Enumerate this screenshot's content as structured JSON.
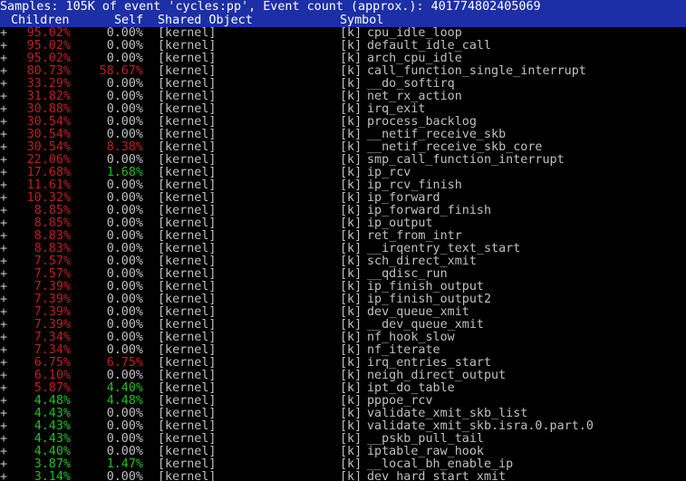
{
  "title": "Samples: 105K of event 'cycles:pp', Event count (approx.): 401774802405069",
  "headers": {
    "children": "Children",
    "self": "Self",
    "shared_object": "Shared Object",
    "symbol": "Symbol"
  },
  "colors": {
    "title_bg": "#1c2fa6",
    "high": "#c02020",
    "medium": "#22c022",
    "low": "#c0c0c0"
  },
  "rows": [
    {
      "expand": "+",
      "children": "95.02%",
      "self": "0.00%",
      "shared": "[kernel]",
      "level": "[k]",
      "symbol": "cpu_idle_loop",
      "children_color": "red",
      "self_color": "gray"
    },
    {
      "expand": "+",
      "children": "95.02%",
      "self": "0.00%",
      "shared": "[kernel]",
      "level": "[k]",
      "symbol": "default_idle_call",
      "children_color": "red",
      "self_color": "gray"
    },
    {
      "expand": "+",
      "children": "95.02%",
      "self": "0.00%",
      "shared": "[kernel]",
      "level": "[k]",
      "symbol": "arch_cpu_idle",
      "children_color": "red",
      "self_color": "gray"
    },
    {
      "expand": "+",
      "children": "80.73%",
      "self": "58.67%",
      "shared": "[kernel]",
      "level": "[k]",
      "symbol": "call_function_single_interrupt",
      "children_color": "red",
      "self_color": "red"
    },
    {
      "expand": "+",
      "children": "33.29%",
      "self": "0.00%",
      "shared": "[kernel]",
      "level": "[k]",
      "symbol": "__do_softirq",
      "children_color": "red",
      "self_color": "gray"
    },
    {
      "expand": "+",
      "children": "31.82%",
      "self": "0.00%",
      "shared": "[kernel]",
      "level": "[k]",
      "symbol": "net_rx_action",
      "children_color": "red",
      "self_color": "gray"
    },
    {
      "expand": "+",
      "children": "30.88%",
      "self": "0.00%",
      "shared": "[kernel]",
      "level": "[k]",
      "symbol": "irq_exit",
      "children_color": "red",
      "self_color": "gray"
    },
    {
      "expand": "+",
      "children": "30.54%",
      "self": "0.00%",
      "shared": "[kernel]",
      "level": "[k]",
      "symbol": "process_backlog",
      "children_color": "red",
      "self_color": "gray"
    },
    {
      "expand": "+",
      "children": "30.54%",
      "self": "0.00%",
      "shared": "[kernel]",
      "level": "[k]",
      "symbol": "__netif_receive_skb",
      "children_color": "red",
      "self_color": "gray"
    },
    {
      "expand": "+",
      "children": "30.54%",
      "self": "8.38%",
      "shared": "[kernel]",
      "level": "[k]",
      "symbol": "__netif_receive_skb_core",
      "children_color": "red",
      "self_color": "red"
    },
    {
      "expand": "+",
      "children": "22.06%",
      "self": "0.00%",
      "shared": "[kernel]",
      "level": "[k]",
      "symbol": "smp_call_function_interrupt",
      "children_color": "red",
      "self_color": "gray"
    },
    {
      "expand": "+",
      "children": "17.68%",
      "self": "1.68%",
      "shared": "[kernel]",
      "level": "[k]",
      "symbol": "ip_rcv",
      "children_color": "red",
      "self_color": "green"
    },
    {
      "expand": "+",
      "children": "11.61%",
      "self": "0.00%",
      "shared": "[kernel]",
      "level": "[k]",
      "symbol": "ip_rcv_finish",
      "children_color": "red",
      "self_color": "gray"
    },
    {
      "expand": "+",
      "children": "10.32%",
      "self": "0.00%",
      "shared": "[kernel]",
      "level": "[k]",
      "symbol": "ip_forward",
      "children_color": "red",
      "self_color": "gray"
    },
    {
      "expand": "+",
      "children": "8.85%",
      "self": "0.00%",
      "shared": "[kernel]",
      "level": "[k]",
      "symbol": "ip_forward_finish",
      "children_color": "red",
      "self_color": "gray"
    },
    {
      "expand": "+",
      "children": "8.85%",
      "self": "0.00%",
      "shared": "[kernel]",
      "level": "[k]",
      "symbol": "ip_output",
      "children_color": "red",
      "self_color": "gray"
    },
    {
      "expand": "+",
      "children": "8.83%",
      "self": "0.00%",
      "shared": "[kernel]",
      "level": "[k]",
      "symbol": "ret_from_intr",
      "children_color": "red",
      "self_color": "gray"
    },
    {
      "expand": "+",
      "children": "8.83%",
      "self": "0.00%",
      "shared": "[kernel]",
      "level": "[k]",
      "symbol": "__irqentry_text_start",
      "children_color": "red",
      "self_color": "gray"
    },
    {
      "expand": "+",
      "children": "7.57%",
      "self": "0.00%",
      "shared": "[kernel]",
      "level": "[k]",
      "symbol": "sch_direct_xmit",
      "children_color": "red",
      "self_color": "gray"
    },
    {
      "expand": "+",
      "children": "7.57%",
      "self": "0.00%",
      "shared": "[kernel]",
      "level": "[k]",
      "symbol": "__qdisc_run",
      "children_color": "red",
      "self_color": "gray"
    },
    {
      "expand": "+",
      "children": "7.39%",
      "self": "0.00%",
      "shared": "[kernel]",
      "level": "[k]",
      "symbol": "ip_finish_output",
      "children_color": "red",
      "self_color": "gray"
    },
    {
      "expand": "+",
      "children": "7.39%",
      "self": "0.00%",
      "shared": "[kernel]",
      "level": "[k]",
      "symbol": "ip_finish_output2",
      "children_color": "red",
      "self_color": "gray"
    },
    {
      "expand": "+",
      "children": "7.39%",
      "self": "0.00%",
      "shared": "[kernel]",
      "level": "[k]",
      "symbol": "dev_queue_xmit",
      "children_color": "red",
      "self_color": "gray"
    },
    {
      "expand": "+",
      "children": "7.39%",
      "self": "0.00%",
      "shared": "[kernel]",
      "level": "[k]",
      "symbol": "__dev_queue_xmit",
      "children_color": "red",
      "self_color": "gray"
    },
    {
      "expand": "+",
      "children": "7.34%",
      "self": "0.00%",
      "shared": "[kernel]",
      "level": "[k]",
      "symbol": "nf_hook_slow",
      "children_color": "red",
      "self_color": "gray"
    },
    {
      "expand": "+",
      "children": "7.34%",
      "self": "0.00%",
      "shared": "[kernel]",
      "level": "[k]",
      "symbol": "nf_iterate",
      "children_color": "red",
      "self_color": "gray"
    },
    {
      "expand": "+",
      "children": "6.75%",
      "self": "6.75%",
      "shared": "[kernel]",
      "level": "[k]",
      "symbol": "irq_entries_start",
      "children_color": "red",
      "self_color": "red"
    },
    {
      "expand": "+",
      "children": "6.10%",
      "self": "0.00%",
      "shared": "[kernel]",
      "level": "[k]",
      "symbol": "neigh_direct_output",
      "children_color": "red",
      "self_color": "gray"
    },
    {
      "expand": "+",
      "children": "5.87%",
      "self": "4.40%",
      "shared": "[kernel]",
      "level": "[k]",
      "symbol": "ipt_do_table",
      "children_color": "red",
      "self_color": "green"
    },
    {
      "expand": "+",
      "children": "4.48%",
      "self": "4.48%",
      "shared": "[kernel]",
      "level": "[k]",
      "symbol": "pppoe_rcv",
      "children_color": "green",
      "self_color": "green"
    },
    {
      "expand": "+",
      "children": "4.43%",
      "self": "0.00%",
      "shared": "[kernel]",
      "level": "[k]",
      "symbol": "validate_xmit_skb_list",
      "children_color": "green",
      "self_color": "gray"
    },
    {
      "expand": "+",
      "children": "4.43%",
      "self": "0.00%",
      "shared": "[kernel]",
      "level": "[k]",
      "symbol": "validate_xmit_skb.isra.0.part.0",
      "children_color": "green",
      "self_color": "gray"
    },
    {
      "expand": "+",
      "children": "4.43%",
      "self": "0.00%",
      "shared": "[kernel]",
      "level": "[k]",
      "symbol": "__pskb_pull_tail",
      "children_color": "green",
      "self_color": "gray"
    },
    {
      "expand": "+",
      "children": "4.40%",
      "self": "0.00%",
      "shared": "[kernel]",
      "level": "[k]",
      "symbol": "iptable_raw_hook",
      "children_color": "green",
      "self_color": "gray"
    },
    {
      "expand": "+",
      "children": "3.87%",
      "self": "1.47%",
      "shared": "[kernel]",
      "level": "[k]",
      "symbol": "__local_bh_enable_ip",
      "children_color": "green",
      "self_color": "green"
    },
    {
      "expand": "+",
      "children": "3.14%",
      "self": "0.00%",
      "shared": "[kernel]",
      "level": "[k]",
      "symbol": "dev_hard_start_xmit",
      "children_color": "green",
      "self_color": "gray"
    }
  ]
}
